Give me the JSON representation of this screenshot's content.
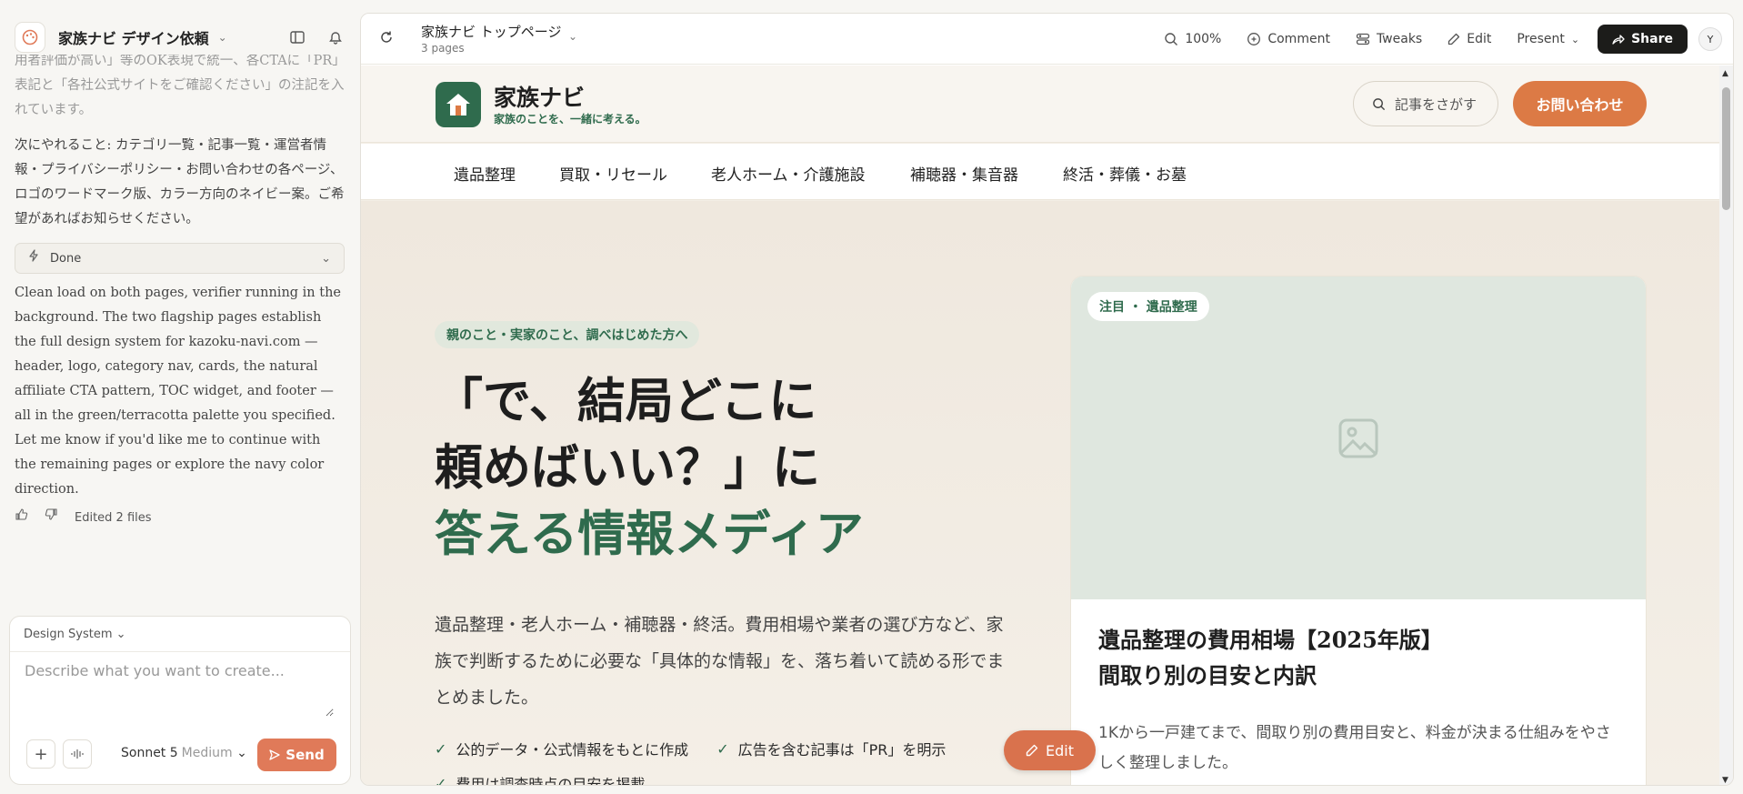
{
  "sidebar": {
    "project_title": "家族ナビ デザイン依頼",
    "messages": [
      "用者評価が高い」等のOK表現で統一、各CTAに「PR」表記と「各社公式サイトをご確認ください」の注記を入れています。",
      "次にやれること: カテゴリ一覧・記事一覧・運営者情報・プライバシーポリシー・お問い合わせの各ページ、ロゴのワードマーク版、カラー方向のネイビー案。ご希望があればお知らせください。"
    ],
    "done_label": "Done",
    "final_message": "Clean load on both pages, verifier running in the background. The two flagship pages establish the full design system for kazoku-navi.com — header, logo, category nav, cards, the natural affiliate CTA pattern, TOC widget, and footer — all in the green/terracotta palette you specified. Let me know if you'd like me to continue with the remaining pages or explore the navy color direction.",
    "edited_files": "Edited 2 files"
  },
  "composer": {
    "design_system": "Design System",
    "placeholder": "Describe what you want to create...",
    "model": "Sonnet 5",
    "effort": "Medium",
    "send": "Send"
  },
  "toolbar": {
    "page_title": "家族ナビ トップページ",
    "page_count": "3 pages",
    "zoom": "100%",
    "comment": "Comment",
    "tweaks": "Tweaks",
    "edit": "Edit",
    "present": "Present",
    "share": "Share",
    "avatar": "Y"
  },
  "site": {
    "logo_name": "家族ナビ",
    "logo_tagline": "家族のことを、一緒に考える。",
    "search": "記事をさがす",
    "contact": "お問い合わせ",
    "categories": [
      "遺品整理",
      "買取・リセール",
      "老人ホーム・介護施設",
      "補聴器・集音器",
      "終活・葬儀・お墓"
    ],
    "hero": {
      "eyebrow": "親のこと・実家のこと、調べはじめた方へ",
      "line1": "「で、結局どこに",
      "line2": "頼めばいい？」に",
      "line3": "答える情報メディア",
      "lead": "遺品整理・老人ホーム・補聴器・終活。費用相場や業者の選び方など、家族で判断するために必要な「具体的な情報」を、落ち着いて読める形でまとめました。",
      "checks": [
        "公的データ・公式情報をもとに作成",
        "広告を含む記事は「PR」を明示",
        "費用は調査時点の目安を掲載"
      ]
    },
    "card": {
      "badge": "注目 ・ 遺品整理",
      "title_line1": "遺品整理の費用相場【2025年版】",
      "title_line2": "間取り別の目安と内訳",
      "desc": "1Kから一戸建てまで、間取り別の費用目安と、料金が決まる仕組みをやさしく整理しました。"
    }
  },
  "floating_edit": "Edit",
  "colors": {
    "brand_green": "#2f6b4d",
    "terracotta": "#dc7a45",
    "send_button": "#e07a59"
  }
}
